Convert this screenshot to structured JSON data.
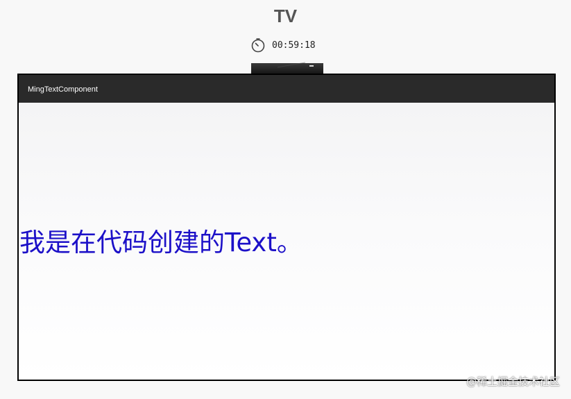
{
  "device": {
    "title": "TV",
    "timer": "00:59:18",
    "timer_icon": "stopwatch-icon"
  },
  "app": {
    "title": "MingTextComponent",
    "created_text": "我是在代码创建的Text。",
    "text_color": "#1c10c8",
    "app_bar_color": "#2a2a2a"
  },
  "watermark": "@稀土掘金技术社区"
}
